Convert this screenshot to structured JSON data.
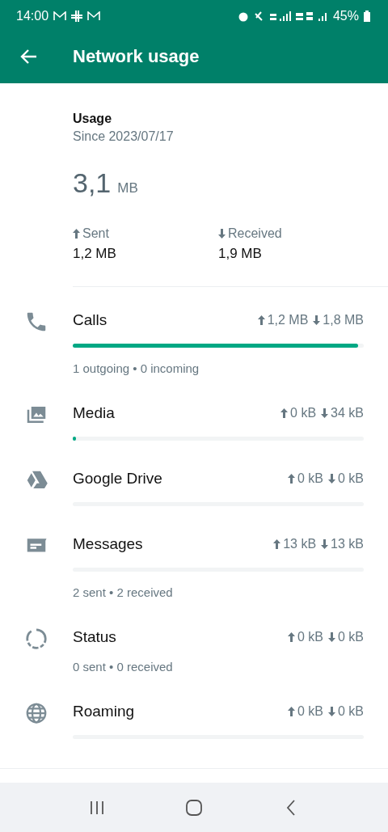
{
  "status_bar": {
    "time": "14:00",
    "battery": "45%"
  },
  "app_bar": {
    "title": "Network usage"
  },
  "summary": {
    "label": "Usage",
    "since": "Since 2023/07/17",
    "total": "3,1",
    "total_unit": "MB",
    "sent_label": "Sent",
    "sent": "1,2 MB",
    "received_label": "Received",
    "received": "1,9 MB"
  },
  "rows": [
    {
      "kind": "calls",
      "title": "Calls",
      "up": "1,2 MB",
      "down": "1,8 MB",
      "level": 0.98,
      "detail": "1 outgoing • 0 incoming"
    },
    {
      "kind": "media",
      "title": "Media",
      "up": "0 kB",
      "down": "34 kB",
      "level": 0.01
    },
    {
      "kind": "drive",
      "title": "Google Drive",
      "up": "0 kB",
      "down": "0 kB",
      "track": true
    },
    {
      "kind": "messages",
      "title": "Messages",
      "up": "13 kB",
      "down": "13 kB",
      "track": true,
      "detail": "2 sent • 2 received"
    },
    {
      "kind": "status",
      "title": "Status",
      "up": "0 kB",
      "down": "0 kB",
      "detail": "0 sent • 0 received"
    },
    {
      "kind": "roaming",
      "title": "Roaming",
      "up": "0 kB",
      "down": "0 kB",
      "track": true
    }
  ]
}
